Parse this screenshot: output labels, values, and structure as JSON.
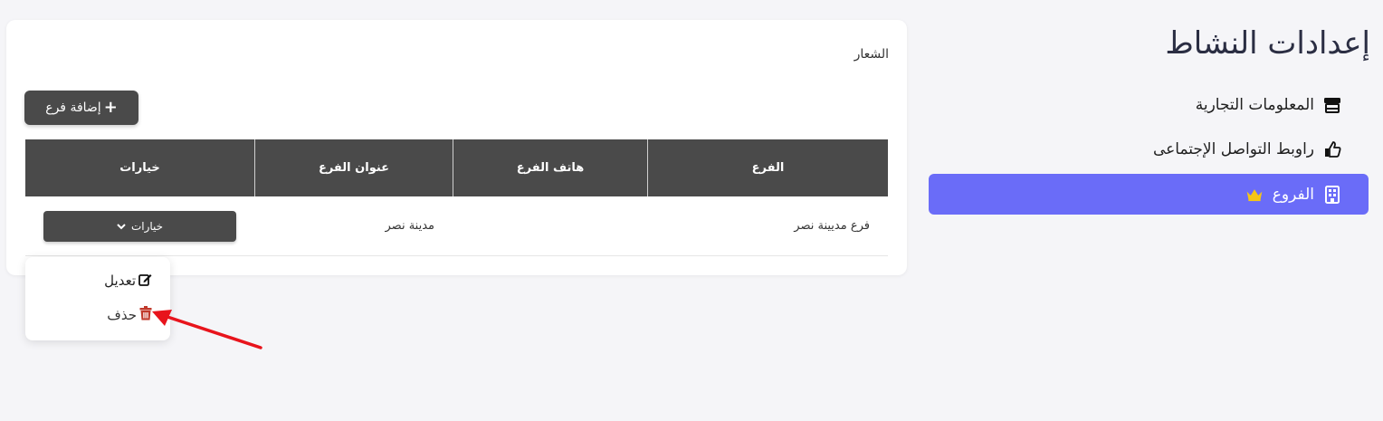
{
  "settings": {
    "title": "إعدادات النشاط",
    "nav": [
      {
        "label": "المعلومات التجارية",
        "icon": "store-icon"
      },
      {
        "label": "راوبط التواصل الإجتماعى",
        "icon": "thumbs-up-icon"
      },
      {
        "label": "الفروع",
        "icon": "building-icon",
        "badge_icon": "crown-icon",
        "active": true
      }
    ]
  },
  "card": {
    "logo_label": "الشعار",
    "add_branch_label": "إضافة فرع",
    "table": {
      "headers": [
        "الفرع",
        "هاتف الفرع",
        "عنوان الفرع",
        "خيارات"
      ],
      "rows": [
        {
          "branch": "فرع مديينة نصر",
          "phone": "",
          "address": "مدينة نصر",
          "options_label": "خيارات"
        }
      ]
    }
  },
  "dropdown": {
    "edit_label": "تعديل",
    "delete_label": "حذف"
  },
  "colors": {
    "accent": "#6a6cf8",
    "dark": "#4a4a4a",
    "delete": "#c0392b",
    "crown": "#f5c518",
    "arrow": "#e8141c"
  }
}
